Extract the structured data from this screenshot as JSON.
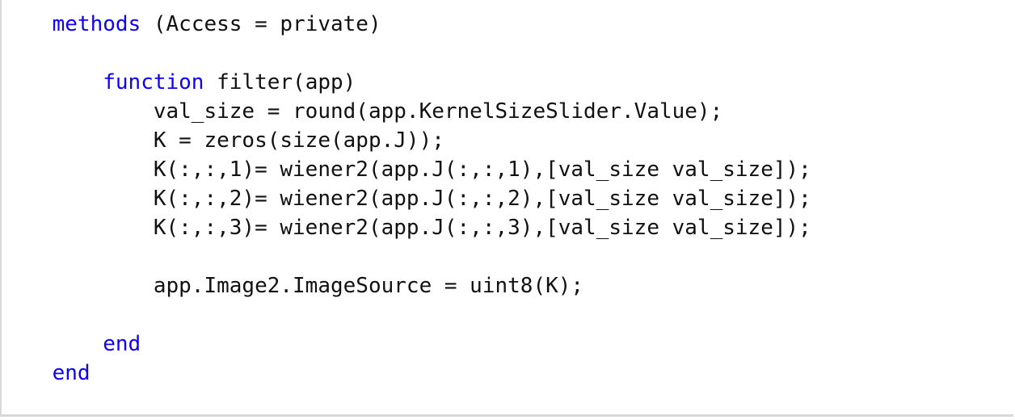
{
  "colors": {
    "keyword": "#0e00ff",
    "text": "#111111",
    "background": "#ffffff",
    "border": "#d9d9d9"
  },
  "code": {
    "lines": [
      {
        "indent": "    ",
        "keyword": "methods",
        "text": " (Access = private)"
      },
      {
        "indent": "",
        "keyword": "",
        "text": ""
      },
      {
        "indent": "        ",
        "keyword": "function",
        "text": " filter(app)"
      },
      {
        "indent": "            ",
        "keyword": "",
        "text": "val_size = round(app.KernelSizeSlider.Value);"
      },
      {
        "indent": "            ",
        "keyword": "",
        "text": "K = zeros(size(app.J));"
      },
      {
        "indent": "            ",
        "keyword": "",
        "text": "K(:,:,1)= wiener2(app.J(:,:,1),[val_size val_size]);"
      },
      {
        "indent": "            ",
        "keyword": "",
        "text": "K(:,:,2)= wiener2(app.J(:,:,2),[val_size val_size]);"
      },
      {
        "indent": "            ",
        "keyword": "",
        "text": "K(:,:,3)= wiener2(app.J(:,:,3),[val_size val_size]);"
      },
      {
        "indent": "",
        "keyword": "",
        "text": ""
      },
      {
        "indent": "            ",
        "keyword": "",
        "text": "app.Image2.ImageSource = uint8(K);"
      },
      {
        "indent": "",
        "keyword": "",
        "text": ""
      },
      {
        "indent": "        ",
        "keyword": "end",
        "text": ""
      },
      {
        "indent": "    ",
        "keyword": "end",
        "text": ""
      }
    ]
  }
}
